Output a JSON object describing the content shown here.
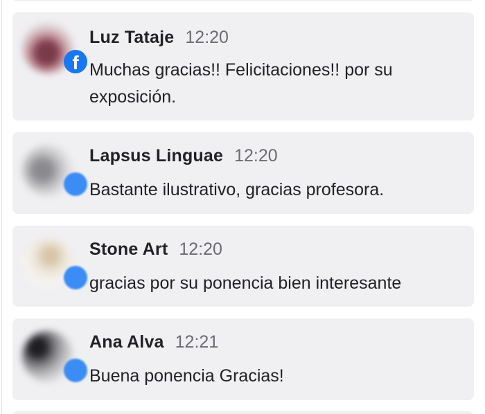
{
  "comments": [
    {
      "author": "Luz Tataje",
      "time": "12:20",
      "text": "Muchas gracias!! Felicitaciones!! por su exposición.",
      "avatar_icon": "avatar-photo",
      "badge_icon": "facebook-icon",
      "badge_glyph": "f"
    },
    {
      "author": "Lapsus Linguae",
      "time": "12:20",
      "text": "Bastante ilustrativo, gracias profesora.",
      "avatar_icon": "avatar-photo",
      "badge_icon": "facebook-icon"
    },
    {
      "author": "Stone Art",
      "time": "12:20",
      "text": "gracias por su ponencia bien interesante",
      "avatar_icon": "avatar-photo",
      "badge_icon": "facebook-icon"
    },
    {
      "author": "Ana Alva",
      "time": "12:21",
      "text": "Buena ponencia Gracias!",
      "avatar_icon": "avatar-photo",
      "badge_icon": "facebook-icon"
    }
  ],
  "colors": {
    "card_background": "#f0f0f3",
    "name_text": "#222226",
    "time_text": "#6b6b72",
    "facebook_blue": "#1877f2"
  }
}
